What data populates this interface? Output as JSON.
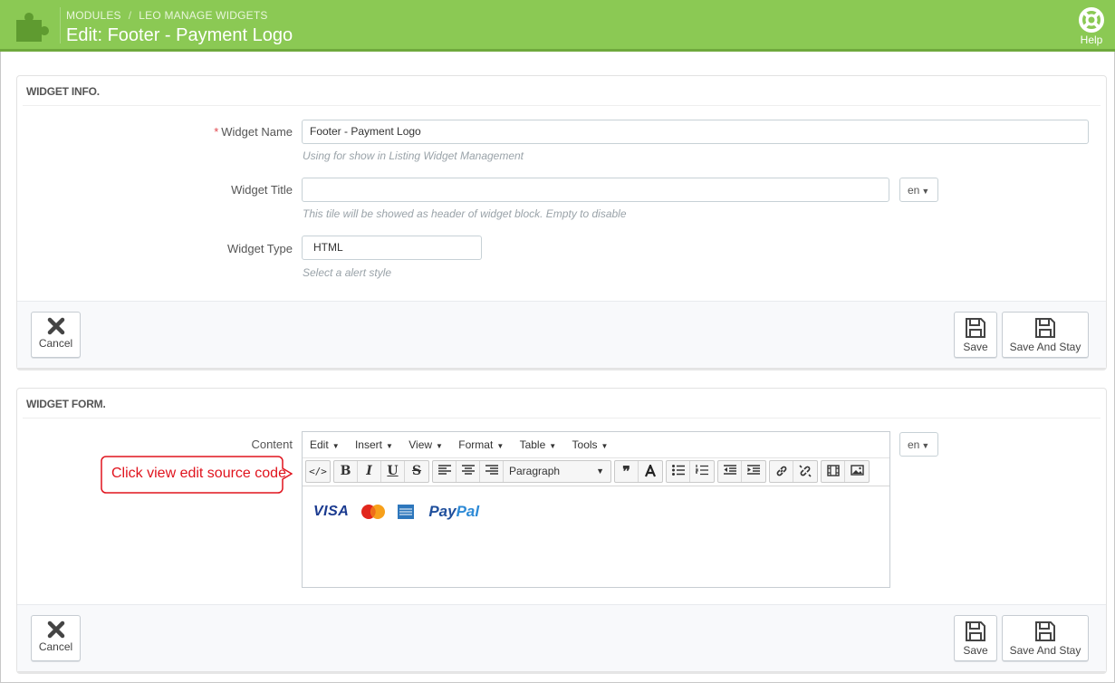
{
  "header": {
    "breadcrumb": [
      "MODULES",
      "LEO MANAGE WIDGETS"
    ],
    "title": "Edit: Footer - Payment Logo",
    "help_label": "Help"
  },
  "widget_info": {
    "heading": "WIDGET INFO.",
    "name": {
      "label": "Widget Name",
      "required_mark": "*",
      "value": "Footer - Payment Logo",
      "help": "Using for show in Listing Widget Management"
    },
    "title": {
      "label": "Widget Title",
      "value": "",
      "lang": "en",
      "help": "This tile will be showed as header of widget block. Empty to disable"
    },
    "type": {
      "label": "Widget Type",
      "value": "HTML",
      "help": "Select a alert style"
    }
  },
  "widget_form": {
    "heading": "WIDGET FORM.",
    "content_label": "Content",
    "lang": "en",
    "menus": [
      "Edit",
      "Insert",
      "View",
      "Format",
      "Table",
      "Tools"
    ],
    "format_select": "Paragraph",
    "toolbar_icons": [
      "source-code",
      "bold",
      "italic",
      "underline",
      "strikethrough",
      "align-left",
      "align-center",
      "align-right",
      "format-select",
      "blockquote",
      "font-color",
      "bullet-list",
      "numbered-list",
      "outdent",
      "indent",
      "link",
      "unlink",
      "media",
      "image"
    ],
    "content_logos": [
      "VISA",
      "MasterCard",
      "American Express",
      "PayPal"
    ],
    "logo_text": {
      "visa": "VISA",
      "mastercard": "MasterCard",
      "paypal_a": "Pay",
      "paypal_b": "Pal"
    }
  },
  "buttons": {
    "cancel": "Cancel",
    "save": "Save",
    "save_and_stay": "Save And Stay"
  },
  "callout": {
    "text": "Click view edit source code",
    "color": "#e0131d"
  },
  "colors": {
    "header_green": "#8bc954",
    "label_required": "#e0484f",
    "paypal_dark": "#1f4f9c",
    "paypal_light": "#2d8ad6"
  }
}
